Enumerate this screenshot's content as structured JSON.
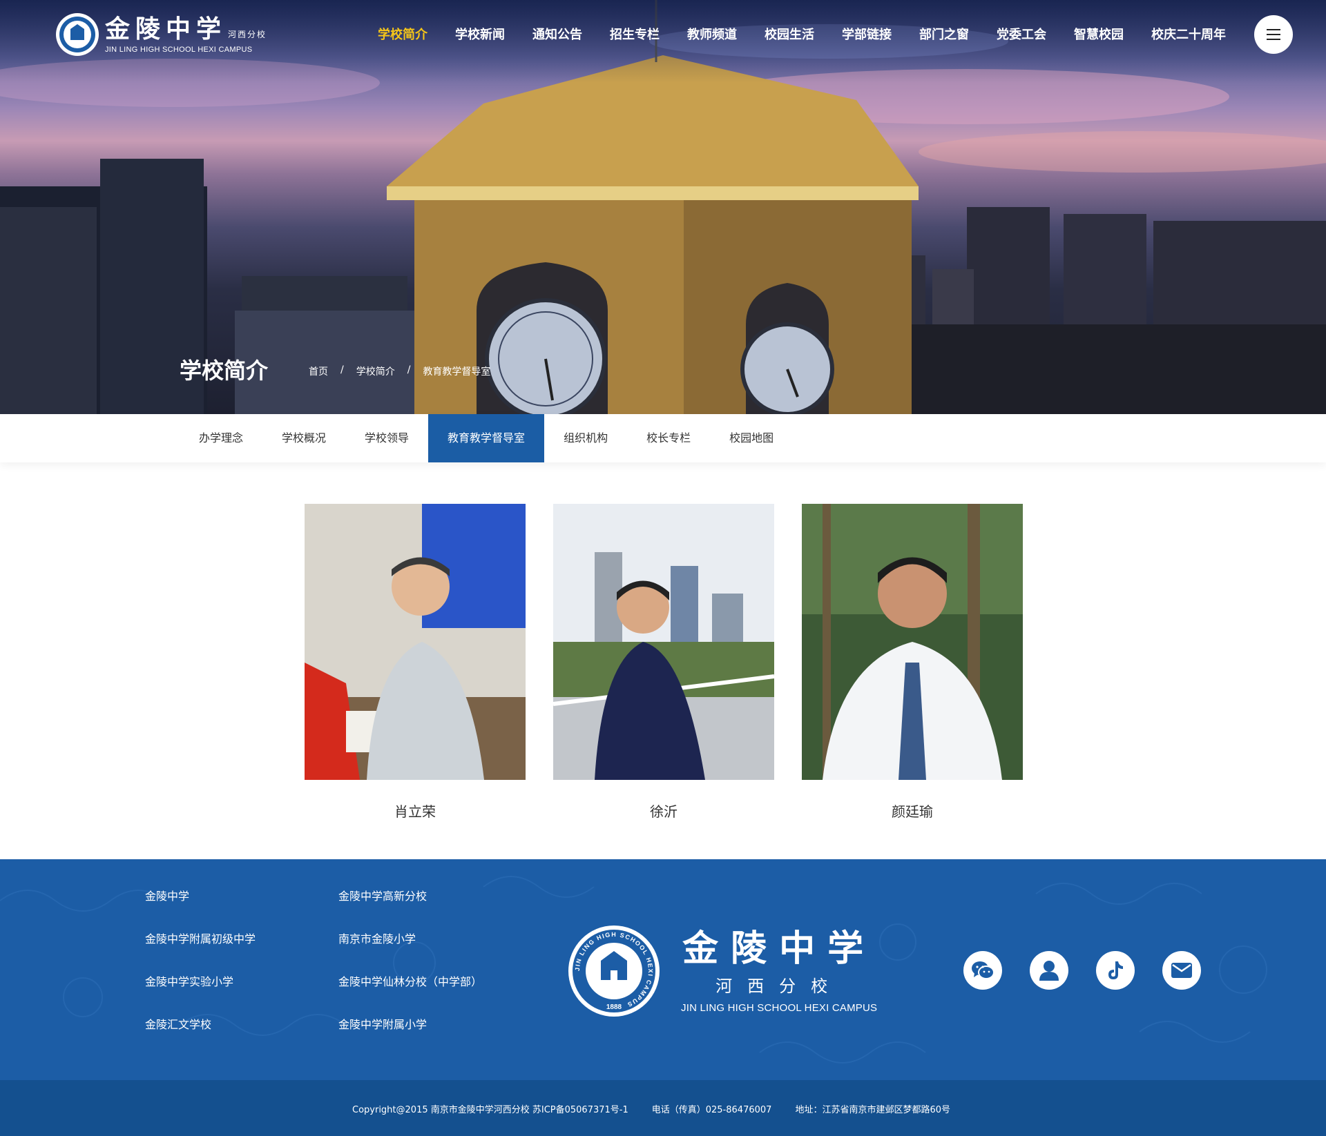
{
  "header": {
    "logo_cn": "金陵中学",
    "logo_cn_sub": "河西分校",
    "logo_en": "JIN LING HIGH SCHOOL HEXI CAMPUS",
    "nav": [
      {
        "label": "学校简介",
        "active": true
      },
      {
        "label": "学校新闻"
      },
      {
        "label": "通知公告"
      },
      {
        "label": "招生专栏"
      },
      {
        "label": "教师频道"
      },
      {
        "label": "校园生活"
      },
      {
        "label": "学部链接"
      },
      {
        "label": "部门之窗"
      },
      {
        "label": "党委工会"
      },
      {
        "label": "智慧校园"
      },
      {
        "label": "校庆二十周年"
      }
    ],
    "menu_icon": "hamburger-icon"
  },
  "hero": {
    "title": "学校简介",
    "breadcrumb": [
      "首页",
      "学校简介",
      "教育教学督导室"
    ],
    "breadcrumb_sep": "/"
  },
  "subnav": {
    "items": [
      {
        "label": "办学理念"
      },
      {
        "label": "学校概况"
      },
      {
        "label": "学校领导"
      },
      {
        "label": "教育教学督导室",
        "active": true
      },
      {
        "label": "组织机构"
      },
      {
        "label": "校长专栏"
      },
      {
        "label": "校园地图"
      }
    ]
  },
  "people": [
    {
      "name": "肖立荣"
    },
    {
      "name": "徐沂"
    },
    {
      "name": "颜廷瑜"
    }
  ],
  "footer": {
    "links_col1": [
      "金陵中学",
      "金陵中学附属初级中学",
      "金陵中学实验小学",
      "金陵汇文学校"
    ],
    "links_col2": [
      "金陵中学高新分校",
      "南京市金陵小学",
      "金陵中学仙林分校（中学部）",
      "金陵中学附属小学"
    ],
    "logo_cn": "金陵中学",
    "logo_cn_sub": "河西分校",
    "logo_en": "JIN LING HIGH SCHOOL HEXI CAMPUS",
    "seal_ring_text": "JIN LING HIGH SCHOOL HEXI CAMPUS",
    "seal_year": "1888",
    "socials": [
      "wechat-icon",
      "user-icon",
      "tiktok-icon",
      "mail-icon"
    ],
    "copyright": "Copyright@2015 南京市金陵中学河西分校  苏ICP备05067371号-1",
    "phone": "电话（传真）025-86476007",
    "address": "地址：江苏省南京市建邺区梦都路60号"
  },
  "colors": {
    "primary_blue": "#1c5da6",
    "active_nav": "#f5c518",
    "bottom_bar": "#14508f"
  }
}
